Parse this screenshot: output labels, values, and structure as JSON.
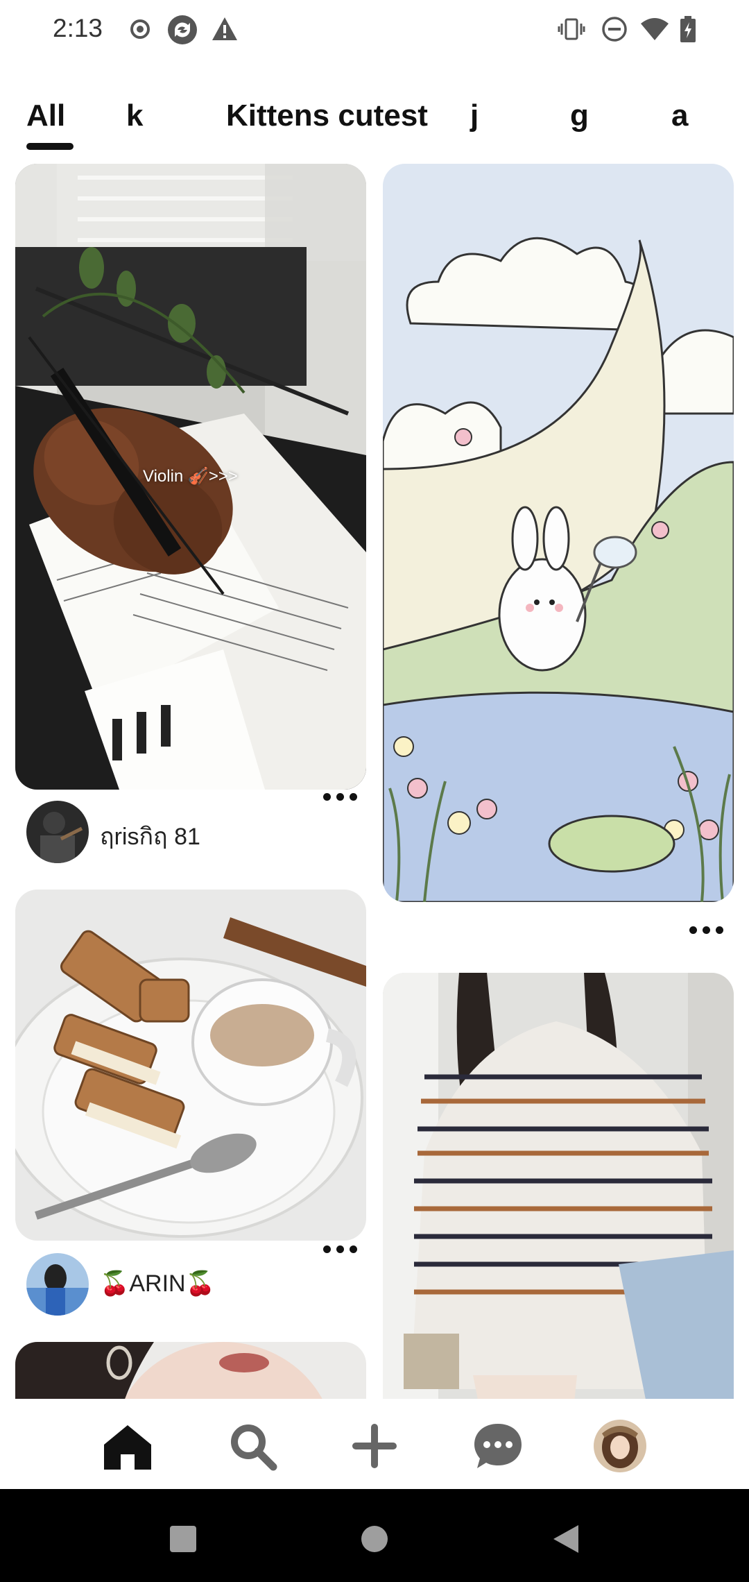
{
  "status_bar": {
    "time": "2:13",
    "left_icons": [
      "record-icon",
      "sync-icon",
      "warning-icon"
    ],
    "right_icons": [
      "vibrate-icon",
      "do-not-disturb-icon",
      "wifi-icon",
      "battery-icon"
    ]
  },
  "tabs": {
    "items": [
      {
        "label": "All",
        "selected": true
      },
      {
        "label": "k",
        "selected": false
      },
      {
        "label": "Kittens cutest",
        "selected": false
      },
      {
        "label": "j",
        "selected": false
      },
      {
        "label": "g",
        "selected": false
      },
      {
        "label": "a",
        "selected": false
      }
    ]
  },
  "feed": {
    "pins": [
      {
        "image": "violin-on-piano-photo",
        "overlay_text": "Violin 🎻>>>",
        "author": "ฤrisกิฤ 81"
      },
      {
        "image": "bunny-moon-illustration"
      },
      {
        "image": "biscoff-sandwich-coffee-photo",
        "author": "🍒ARIN🍒"
      },
      {
        "image": "striped-sweater-photo"
      },
      {
        "image": "portrait-earring-photo"
      }
    ]
  },
  "bottom_nav": {
    "items": [
      {
        "icon": "home-icon",
        "active": true
      },
      {
        "icon": "search-icon"
      },
      {
        "icon": "plus-icon"
      },
      {
        "icon": "chat-icon"
      },
      {
        "icon": "profile-avatar"
      }
    ]
  },
  "system_nav": {
    "buttons": [
      "recents-square-icon",
      "home-circle-icon",
      "back-triangle-icon"
    ]
  },
  "colors": {
    "text": "#111111",
    "status_icon": "#555555",
    "system_bar": "#000000"
  }
}
